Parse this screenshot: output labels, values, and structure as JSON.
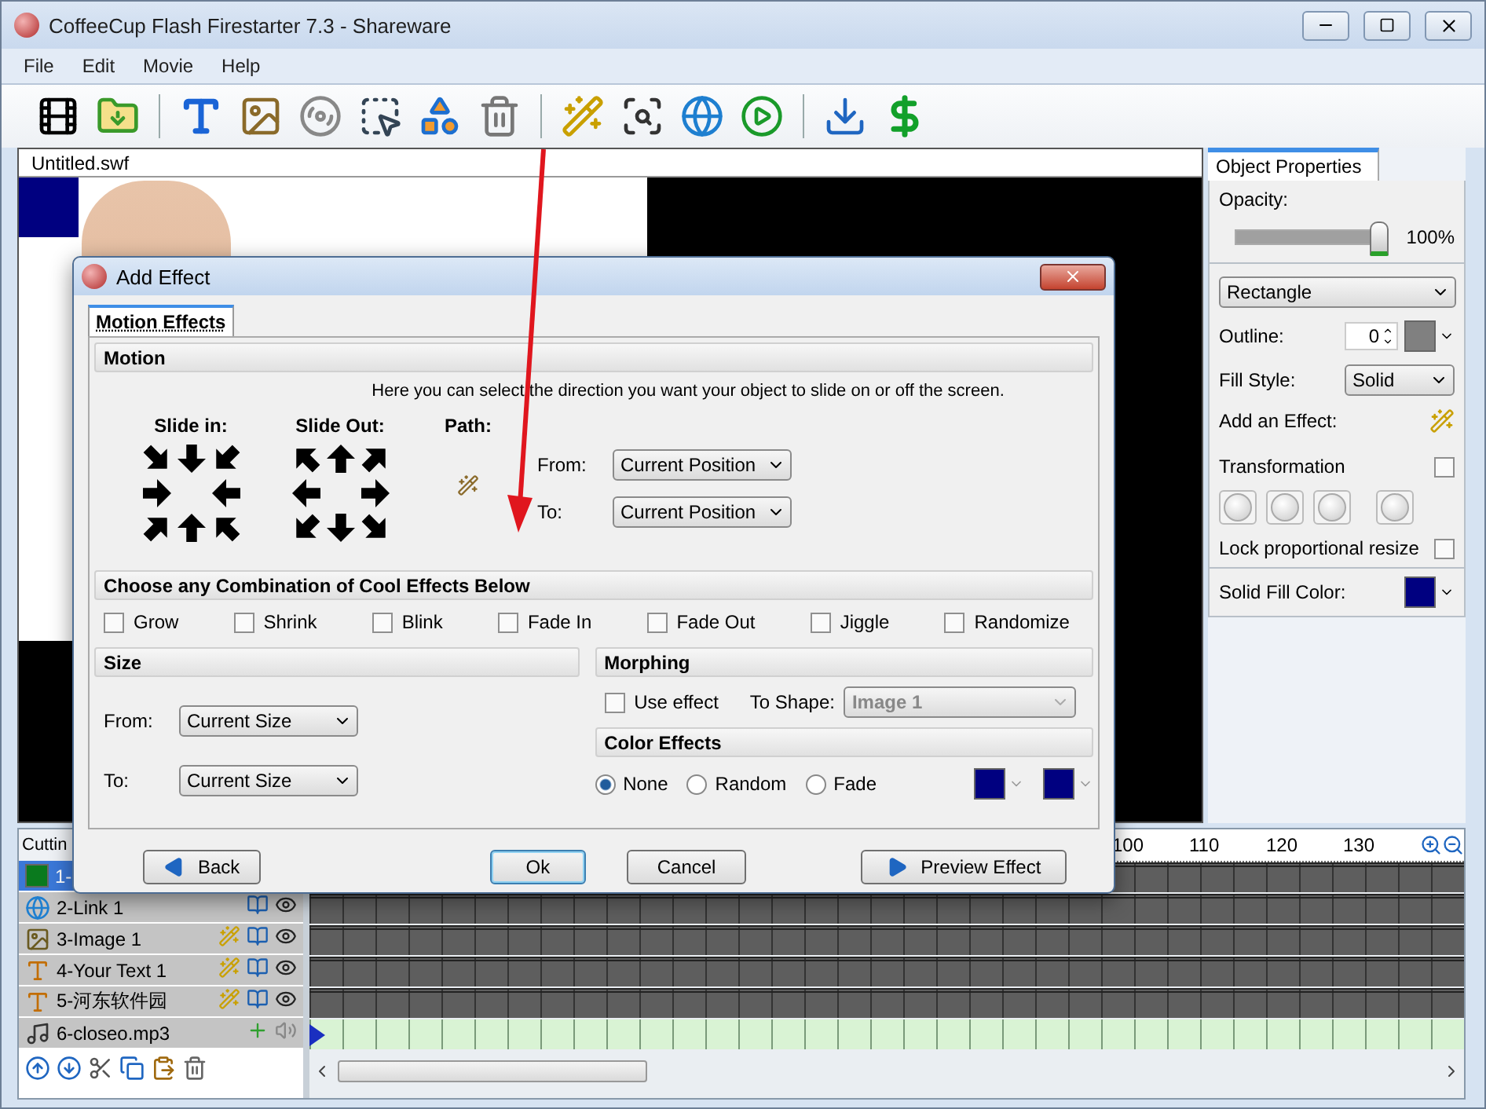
{
  "window": {
    "title": "CoffeeCup Flash Firestarter 7.3 - Shareware"
  },
  "menu": [
    "File",
    "Edit",
    "Movie",
    "Help"
  ],
  "document": {
    "tab": "Untitled.swf"
  },
  "properties": {
    "tab": "Object Properties",
    "opacity_label": "Opacity:",
    "opacity": {
      "level": 0.95,
      "reading": "100%"
    },
    "shape": "Rectangle",
    "outline_label": "Outline:",
    "outline_value": "0",
    "fill_style_label": "Fill Style:",
    "fill_style": "Solid",
    "add_effect_label": "Add an Effect:",
    "transformation": {
      "label": "Transformation",
      "checked": false
    },
    "lock": {
      "label": "Lock proportional resize",
      "checked": false
    },
    "solid_fill": {
      "label": "Solid Fill Color:",
      "color": "#000080"
    }
  },
  "timeline": {
    "header": "Cuttin",
    "ruler": [
      "100",
      "110",
      "120",
      "130"
    ],
    "layers": [
      {
        "name": "1-",
        "kind": "shape",
        "selected": true
      },
      {
        "name": "2-Link 1",
        "kind": "link",
        "selected": false
      },
      {
        "name": "3-Image 1",
        "kind": "image",
        "selected": false
      },
      {
        "name": "4-Your Text 1",
        "kind": "text",
        "selected": false
      },
      {
        "name": "5-河东软件园",
        "kind": "text",
        "selected": false
      },
      {
        "name": "6-closeo.mp3",
        "kind": "sound",
        "selected": false
      }
    ]
  },
  "dialog": {
    "title": "Add Effect",
    "tabs": [
      {
        "label": "Motion Effects",
        "selected": true
      }
    ],
    "motion": {
      "heading": "Motion",
      "hint": "Here you can select the direction you want your object to slide on or off the screen.",
      "slide_in": "Slide in:",
      "slide_out": "Slide Out:",
      "path": "Path:",
      "from_label": "From:",
      "from": "Current Position",
      "to_label": "To:",
      "to": "Current Position"
    },
    "effects": {
      "heading": "Choose any Combination of Cool Effects Below",
      "items": [
        {
          "label": "Grow",
          "checked": false
        },
        {
          "label": "Shrink",
          "checked": false
        },
        {
          "label": "Blink",
          "checked": false
        },
        {
          "label": "Fade In",
          "checked": false
        },
        {
          "label": "Fade Out",
          "checked": false
        },
        {
          "label": "Jiggle",
          "checked": false
        },
        {
          "label": "Randomize",
          "checked": false
        }
      ]
    },
    "size": {
      "heading": "Size",
      "from_label": "From:",
      "from": "Current Size",
      "to_label": "To:",
      "to": "Current Size"
    },
    "morphing": {
      "heading": "Morphing",
      "use_effect": {
        "label": "Use effect",
        "checked": false
      },
      "to_shape_label": "To Shape:",
      "to_shape": "Image 1",
      "disabled": true
    },
    "color_effects": {
      "heading": "Color Effects",
      "options": [
        {
          "label": "None",
          "selected": true
        },
        {
          "label": "Random",
          "selected": false
        },
        {
          "label": "Fade",
          "selected": false
        }
      ],
      "swatches": [
        {
          "color": "#000080"
        },
        {
          "color": "#000080"
        }
      ]
    },
    "buttons": [
      {
        "label": "Back",
        "kind": "back",
        "default": false
      },
      {
        "label": "Ok",
        "kind": "ok",
        "default": true
      },
      {
        "label": "Cancel",
        "kind": "cancel",
        "default": false
      },
      {
        "label": "Preview Effect",
        "kind": "preview",
        "default": false
      }
    ]
  }
}
